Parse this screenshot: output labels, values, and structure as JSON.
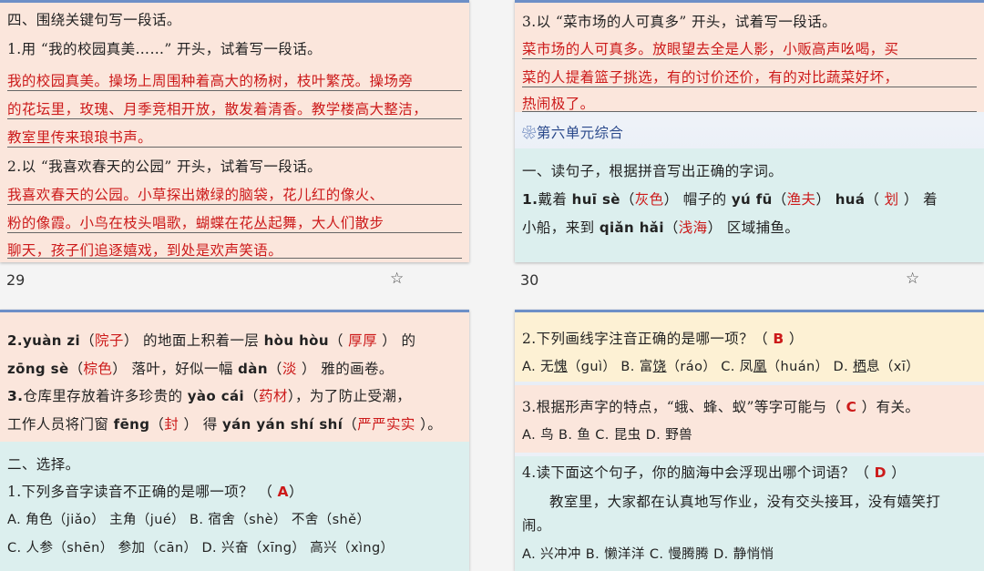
{
  "slide29": {
    "heading": "四、围绕关键句写一段话。",
    "q1_prompt": "1.用 “我的校园真美……” 开头，试着写一段话。",
    "q1_answer": [
      "我的校园真美。操场上周围种着高大的杨树，枝叶繁茂。操场旁",
      "的花坛里，玫瑰、月季竞相开放，散发着清香。教学楼高大整洁，",
      "教室里传来琅琅书声。"
    ],
    "q2_prompt": "2.以 “我喜欢春天的公园” 开头，试着写一段话。",
    "q2_answer": [
      "我喜欢春天的公园。小草探出嫩绿的脑袋，花儿红的像火、",
      "粉的像霞。小鸟在枝头唱歌，蝴蝶在花丛起舞，大人们散步",
      "聊天，孩子们追逐嬉戏，到处是欢声笑语。"
    ],
    "page_number": "29",
    "star_icon": "star-outline-icon"
  },
  "slide30": {
    "q3_prompt": "3.以 “菜市场的人可真多” 开头，试着写一段话。",
    "q3_answer": [
      "菜市场的人可真多。放眼望去全是人影，小贩高声吆喝，买",
      "菜的人提着篮子挑选，有的讨价还价，有的对比蔬菜好坏，",
      "热闹极了。"
    ],
    "unit_icon": "flower-icon",
    "unit_title": "第六单元综合",
    "section_heading": "一、读句子，根据拼音写出正确的字词。",
    "line1": {
      "num": "1.",
      "a": "戴着 ",
      "py1": "huī sè",
      "ans1": "灰色",
      "b": " 帽子的 ",
      "py2": "yú fū",
      "ans2": "渔夫",
      "py3": "huá",
      "ans3": "划",
      "c": " 着"
    },
    "line2": {
      "a": "小船，来到 ",
      "py": "qiǎn hǎi",
      "ans": "浅海",
      "b": " 区域捕鱼。"
    },
    "page_number": "30",
    "star_icon": "star-outline-icon"
  },
  "slide31": {
    "q2": {
      "num": "2.",
      "py1": "yuàn zi",
      "ans1": "院子",
      "a": " 的地面上积着一层 ",
      "py2": "hòu hòu",
      "ans2": "厚厚",
      "b": " 的"
    },
    "q2b": {
      "py1": "zōng sè",
      "ans1": "棕色",
      "a": " 落叶，好似一幅 ",
      "py2": "dàn",
      "ans2": "淡",
      "b": " 雅的画卷。"
    },
    "q3": {
      "num": "3.",
      "a": "仓库里存放着许多珍贵的 ",
      "py1": "yào cái",
      "ans1": "药材",
      "b": "，为了防止受潮，"
    },
    "q3b": {
      "a": "工作人员将门窗 ",
      "py1": "fēng",
      "ans1": "封",
      "b": " 得 ",
      "py2": "yán yán shí shí",
      "ans2": "严严实实",
      "c": "。"
    },
    "section2": "二、选择。",
    "choice1": {
      "prompt": "1.下列多音字读音不正确的是哪一项？ （ ",
      "ans": "A",
      "end": "）"
    },
    "choice1_optA": "A. 角色（jiǎo）  主角（jué）   B. 宿舍（shè）  不舍（shě）",
    "choice1_optC": "C. 人参（shēn）  参加（cān）  D. 兴奋（xīng）  高兴（xìng）"
  },
  "slide32": {
    "q2": {
      "prompt": "2.下列画线字注音正确的是哪一项？（ ",
      "ans": "B",
      "end": " ）"
    },
    "q2_opts": [
      {
        "label": "A. 无",
        "char": "愧",
        "py": "（guì）"
      },
      {
        "label": "B. 富",
        "char": "饶",
        "py": "（ráo）"
      },
      {
        "label": "C. 凤",
        "char": "凰",
        "py": "（huán）"
      },
      {
        "label": "D. ",
        "char": "栖",
        "py": "息（xī）"
      }
    ],
    "q3": {
      "prompt": "3.根据形声字的特点，“蛾、蜂、蚁”等字可能与（ ",
      "ans": "C",
      "end": " ）有关。"
    },
    "q3_opts": "A. 鸟  B. 鱼  C. 昆虫  D. 野兽",
    "q4": {
      "prompt": "4.读下面这个句子，你的脑海中会浮现出哪个词语？（ ",
      "ans": "D",
      "end": " ）"
    },
    "q4_sentence": [
      "教室里，大家都在认真地写作业，没有交头接耳，没有嬉笑打",
      "闹。"
    ],
    "q4_opts": "A. 兴冲冲  B. 懒洋洋  C. 慢腾腾  D. 静悄悄"
  },
  "colors": {
    "answer": "#cc1a1a",
    "peach_panel": "#fbe6dc",
    "mint_panel": "#dcefee",
    "slide_border": "#6d8fc7"
  }
}
